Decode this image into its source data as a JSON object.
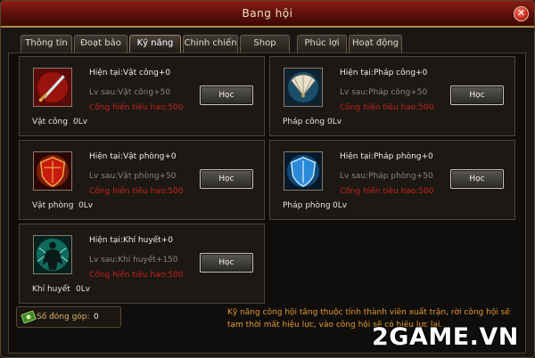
{
  "window": {
    "title": "Bang hội"
  },
  "tabs": [
    {
      "label": "Thông tin"
    },
    {
      "label": "Đoạt bảo"
    },
    {
      "label": "Kỹ năng"
    },
    {
      "label": "Chinh chiến"
    },
    {
      "label": "Shop"
    },
    {
      "label": "Phúc lợi"
    },
    {
      "label": "Hoạt động"
    }
  ],
  "active_tab": "Kỹ năng",
  "skills": [
    {
      "name": "Vật công",
      "level": "0Lv",
      "current": "Hiện tại:Vật công+0",
      "next": "Lv sau:Vật công+50",
      "cost": "Cống hiến tiêu hao:500",
      "button": "Học",
      "icon": "sword-icon"
    },
    {
      "name": "Pháp công",
      "level": "0Lv",
      "current": "Hiện tại:Pháp công+0",
      "next": "Lv sau:Pháp công+50",
      "cost": "Cống hiến tiêu hao:500",
      "button": "Học",
      "icon": "fan-icon"
    },
    {
      "name": "Vật phòng",
      "level": "0Lv",
      "current": "Hiện tại:Vật phòng+0",
      "next": "Lv sau:Vật phòng+50",
      "cost": "Cống hiến tiêu hao:500",
      "button": "Học",
      "icon": "red-shield-icon"
    },
    {
      "name": "Pháp phòng",
      "level": "0Lv",
      "current": "Hiện tại:Pháp phòng+0",
      "next": "Lv sau:Pháp phòng+50",
      "cost": "Cống hiến tiêu hao:500",
      "button": "Học",
      "icon": "blue-shield-icon"
    },
    {
      "name": "Khí huyết",
      "level": "0Lv",
      "current": "Hiện tại:Khí huyết+0",
      "next": "Lv sau:Khí huyết+150",
      "cost": "Cống hiến tiêu hao:500",
      "button": "Học",
      "icon": "vitality-icon"
    }
  ],
  "contribution": {
    "label": "Số đóng góp:",
    "value": "0",
    "icon": "banknote-icon"
  },
  "notice": "Kỹ năng công hội tăng thuộc tính thành viên xuất trận, rời công hội sẽ tạm thời mất hiệu lực, vào công hội sẽ có hiệu lực lại.",
  "watermark": "2GAME.VN",
  "colors": {
    "title_bar": "#6a1410",
    "cost_text": "#c8201a",
    "notice_text": "#e49a2a"
  }
}
